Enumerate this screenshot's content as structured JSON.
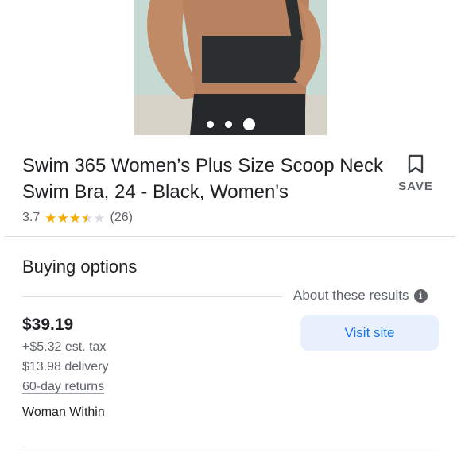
{
  "product": {
    "title": "Swim 365 Women’s Plus Size Scoop Neck Swim Bra, 24 - Black, Women's",
    "image_alt": "swim bra product photo",
    "carousel": {
      "count": 3,
      "active": 3
    }
  },
  "save": {
    "label": "SAVE",
    "icon": "bookmark-icon"
  },
  "rating": {
    "score": "3.7",
    "stars_value": 3.7,
    "stars_max": 5,
    "reviews": "(26)"
  },
  "buying_options": {
    "heading": "Buying options"
  },
  "about": {
    "label": "About these results",
    "icon": "info-icon",
    "icon_glyph": "i"
  },
  "offer": {
    "price": "$39.19",
    "tax": "+$5.32 est. tax",
    "delivery": "$13.98 delivery",
    "returns": "60-day returns",
    "seller": "Woman Within",
    "visit_label": "Visit site"
  },
  "colors": {
    "accent": "#1a73e8",
    "button_bg": "#e8f0fe",
    "star": "#f9ab00"
  }
}
